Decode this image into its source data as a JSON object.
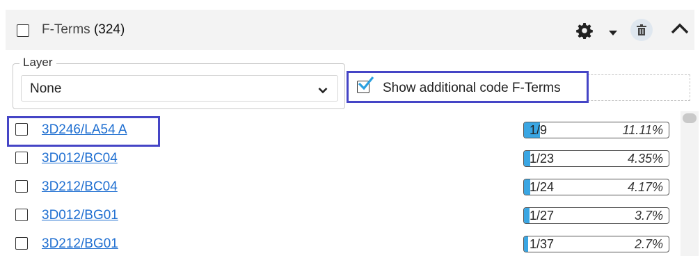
{
  "header": {
    "title": "F-Terms",
    "count": "(324)",
    "icons": [
      "settings-gear-icon",
      "caret-down-icon",
      "trash-icon",
      "chevron-up-icon"
    ]
  },
  "layer": {
    "legend": "Layer",
    "selected": "None"
  },
  "additional": {
    "label": "Show additional code F-Terms",
    "checked": true
  },
  "colors": {
    "link": "#1f6fd1",
    "highlight": "#4545c6",
    "bar_fill": "#3aa6e3",
    "checkmark": "#2aa0e0"
  },
  "rows": [
    {
      "term": "3D246/LA54 A",
      "fraction": "1/9",
      "percent": "11.11%",
      "fill": 0.1111
    },
    {
      "term": "3D012/BC04",
      "fraction": "1/23",
      "percent": "4.35%",
      "fill": 0.0435
    },
    {
      "term": "3D212/BC04",
      "fraction": "1/24",
      "percent": "4.17%",
      "fill": 0.0417
    },
    {
      "term": "3D012/BG01",
      "fraction": "1/27",
      "percent": "3.7%",
      "fill": 0.037
    },
    {
      "term": "3D212/BG01",
      "fraction": "1/37",
      "percent": "2.7%",
      "fill": 0.027
    }
  ]
}
